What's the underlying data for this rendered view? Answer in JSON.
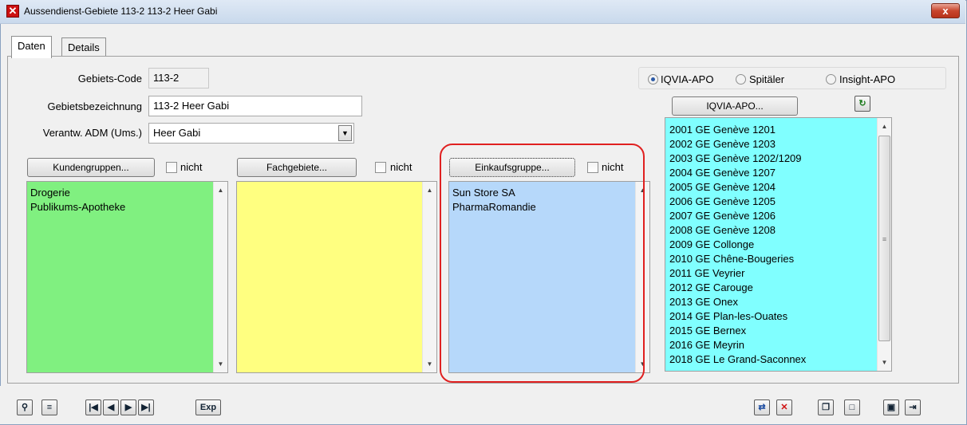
{
  "window": {
    "title": "Aussendienst-Gebiete 113-2 113-2 Heer Gabi",
    "close_label": "x"
  },
  "tabs": [
    {
      "label": "Daten"
    },
    {
      "label": "Details"
    }
  ],
  "form": {
    "gebiets_code_label": "Gebiets-Code",
    "gebiets_code_value": "113-2",
    "bezeichnung_label": "Gebietsbezeichnung",
    "bezeichnung_value": "113-2 Heer Gabi",
    "verantw_label": "Verantw. ADM (Ums.)",
    "verantw_value": "Heer Gabi"
  },
  "panels": {
    "kundengruppen": {
      "button": "Kundengruppen...",
      "nicht": "nicht",
      "items": [
        "Drogerie",
        "Publikums-Apotheke"
      ],
      "color": "#80f080"
    },
    "fachgebiete": {
      "button": "Fachgebiete...",
      "nicht": "nicht",
      "items": [],
      "color": "#ffff80"
    },
    "einkaufsgruppe": {
      "button": "Einkaufsgruppe...",
      "nicht": "nicht",
      "items": [
        "Sun Store SA",
        "PharmaRomandie"
      ],
      "color": "#b6d8fa"
    }
  },
  "source": {
    "options": [
      "IQVIA-APO",
      "Spitäler",
      "Insight-APO"
    ],
    "selected": "IQVIA-APO",
    "button": "IQVIA-APO...",
    "color": "#80ffff",
    "items": [
      "2001  GE Genève 1201",
      "2002  GE Genève 1203",
      "2003  GE Genève 1202/1209",
      "2004  GE Genève 1207",
      "2005  GE Genève 1204",
      "2006  GE Genève 1205",
      "2007  GE Genève 1206",
      "2008  GE Genève 1208",
      "2009  GE Collonge",
      "2010  GE Chêne-Bougeries",
      "2011  GE Veyrier",
      "2012  GE Carouge",
      "2013  GE Onex",
      "2014  GE Plan-les-Ouates",
      "2015  GE Bernex",
      "2016  GE Meyrin",
      "2018  GE Le Grand-Saconnex"
    ]
  },
  "toolbar": {
    "exp_label": "Exp"
  }
}
